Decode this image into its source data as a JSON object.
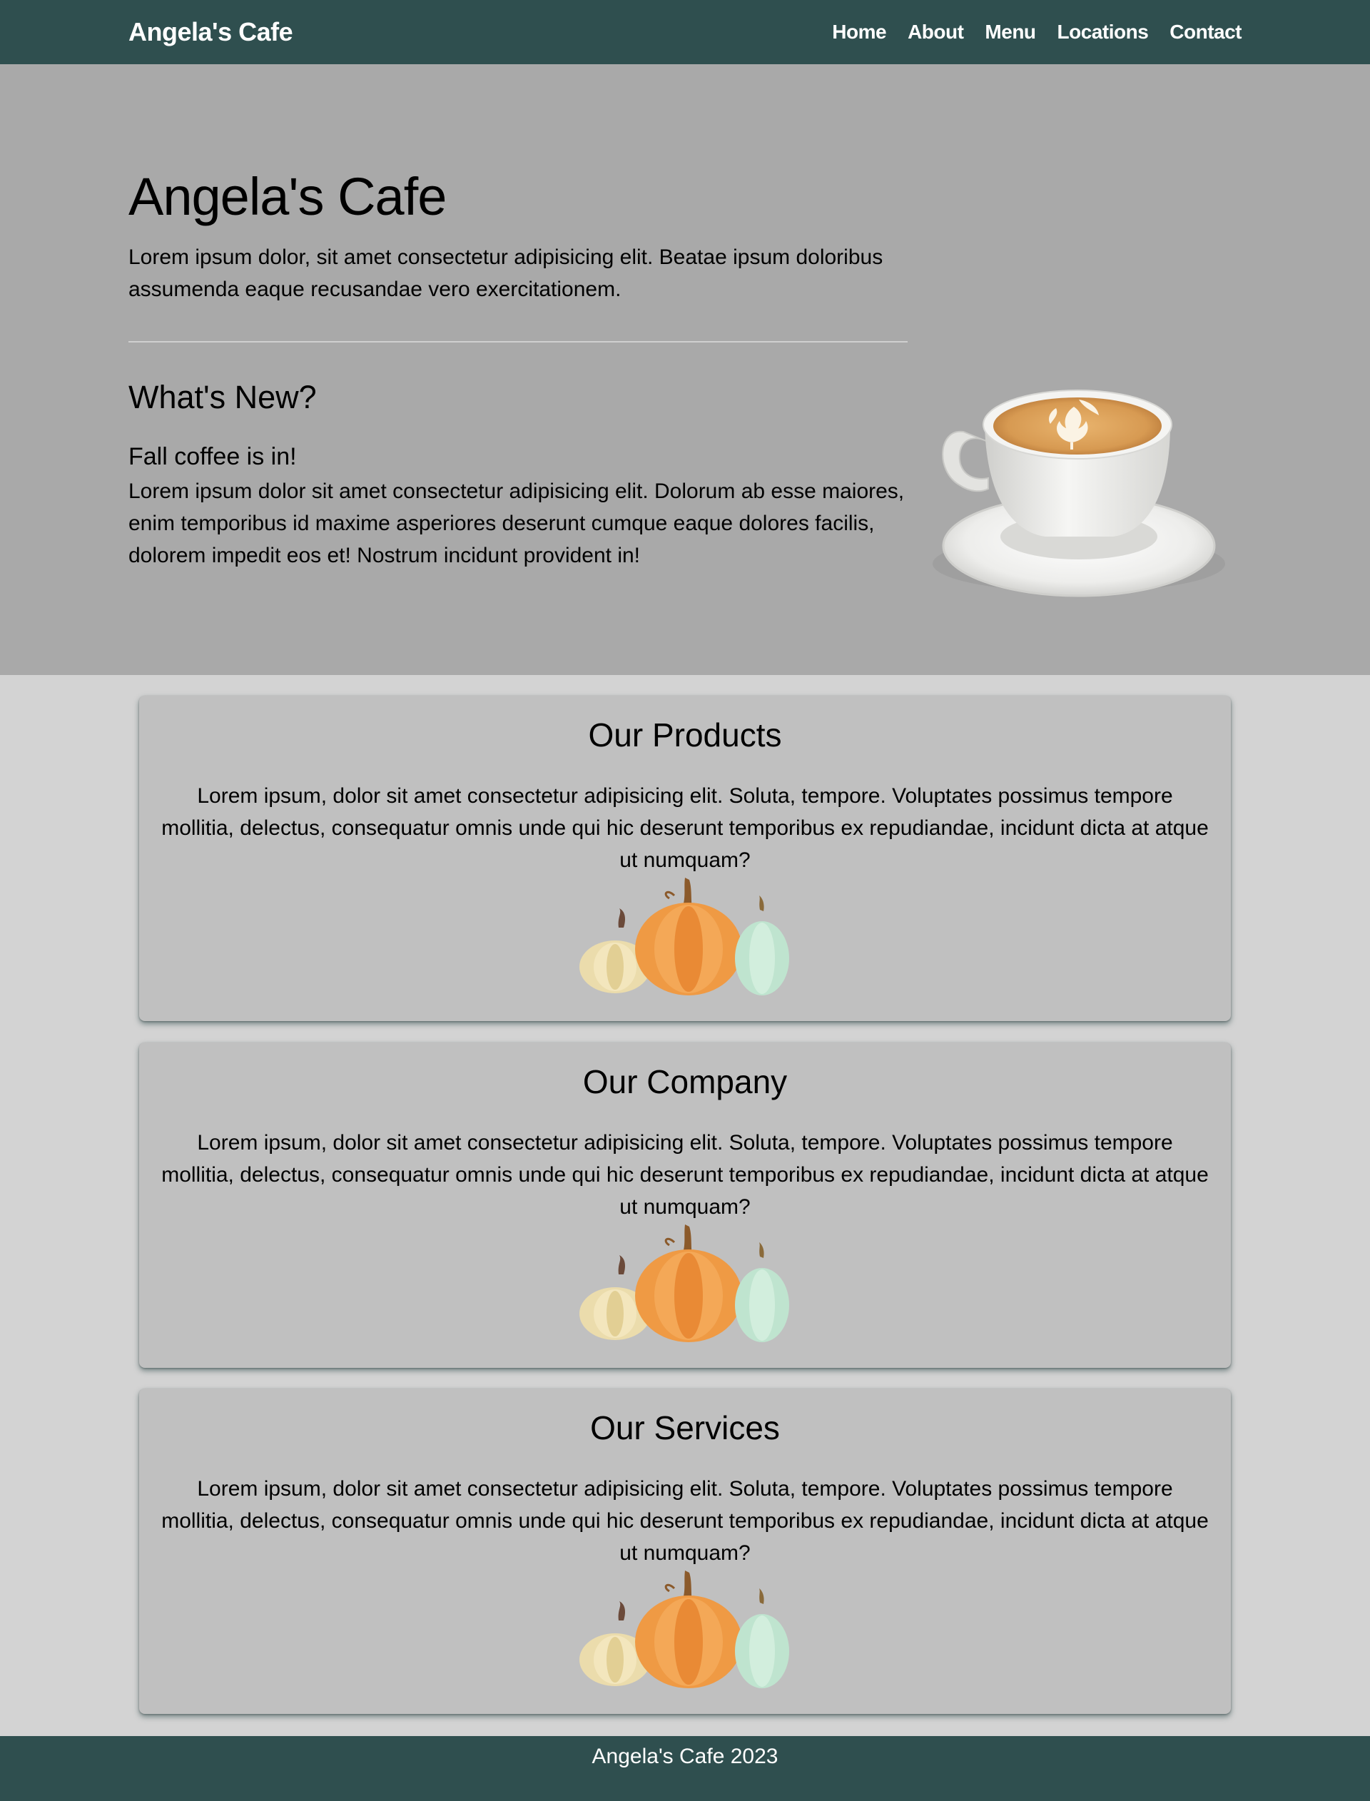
{
  "navbar": {
    "brand": "Angela's Cafe",
    "links": [
      "Home",
      "About",
      "Menu",
      "Locations",
      "Contact"
    ]
  },
  "hero": {
    "title": "Angela's Cafe",
    "lead": "Lorem ipsum dolor, sit amet consectetur adipisicing elit. Beatae ipsum doloribus assumenda eaque recusandae vero exercitationem.",
    "news_title": "What's New?",
    "news_subtitle": "Fall coffee is in!",
    "news_body": "Lorem ipsum dolor sit amet consectetur adipisicing elit. Dolorum ab esse maiores, enim temporibus id maxime asperiores deserunt cumque eaque dolores facilis, dolorem impedit eos et! Nostrum incidunt provident in!"
  },
  "cards": [
    {
      "title": "Our Products",
      "text": "Lorem ipsum, dolor sit amet consectetur adipisicing elit. Soluta, tempore. Voluptates possimus tempore mollitia, delectus, consequatur omnis unde qui hic deserunt temporibus ex repudiandae, incidunt dicta at atque ut numquam?"
    },
    {
      "title": "Our Company",
      "text": "Lorem ipsum, dolor sit amet consectetur adipisicing elit. Soluta, tempore. Voluptates possimus tempore mollitia, delectus, consequatur omnis unde qui hic deserunt temporibus ex repudiandae, incidunt dicta at atque ut numquam?"
    },
    {
      "title": "Our Services",
      "text": "Lorem ipsum, dolor sit amet consectetur adipisicing elit. Soluta, tempore. Voluptates possimus tempore mollitia, delectus, consequatur omnis unde qui hic deserunt temporibus ex repudiandae, incidunt dicta at atque ut numquam?"
    }
  ],
  "footer": {
    "text": "Angela's Cafe 2023"
  },
  "colors": {
    "navbar": "#2f4f4f",
    "hero": "#a9a9a9",
    "page": "#d3d3d3",
    "card": "#c0c0c0"
  }
}
